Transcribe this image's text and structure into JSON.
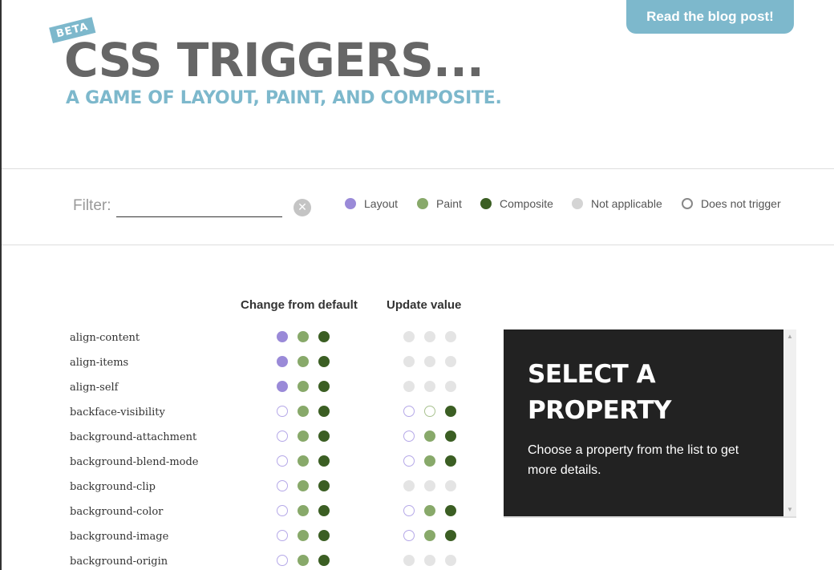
{
  "header": {
    "blog_button": "Read the blog post!",
    "badge": "BETA",
    "title": "CSS TRIGGERS...",
    "subtitle": "A GAME OF LAYOUT, PAINT, AND COMPOSITE."
  },
  "filter": {
    "label": "Filter:",
    "value": "",
    "placeholder": "",
    "clear_glyph": "✕"
  },
  "legend": [
    {
      "label": "Layout",
      "color": "#9a8ad8",
      "style": "filled"
    },
    {
      "label": "Paint",
      "color": "#88a96a",
      "style": "filled"
    },
    {
      "label": "Composite",
      "color": "#3b5e23",
      "style": "filled"
    },
    {
      "label": "Not applicable",
      "color": "#d4d4d4",
      "style": "filled"
    },
    {
      "label": "Does not trigger",
      "color": "#888888",
      "style": "outline"
    }
  ],
  "columns": {
    "change": "Change from default",
    "update": "Update value"
  },
  "properties": [
    {
      "name": "align-content",
      "change": [
        "layout",
        "paint",
        "composite"
      ],
      "update": [
        "na",
        "na",
        "na"
      ]
    },
    {
      "name": "align-items",
      "change": [
        "layout",
        "paint",
        "composite"
      ],
      "update": [
        "na",
        "na",
        "na"
      ]
    },
    {
      "name": "align-self",
      "change": [
        "layout",
        "paint",
        "composite"
      ],
      "update": [
        "na",
        "na",
        "na"
      ]
    },
    {
      "name": "backface-visibility",
      "change": [
        "none-layout",
        "paint",
        "composite"
      ],
      "update": [
        "none-layout",
        "none-paint",
        "composite"
      ]
    },
    {
      "name": "background-attachment",
      "change": [
        "none-layout",
        "paint",
        "composite"
      ],
      "update": [
        "none-layout",
        "paint",
        "composite"
      ]
    },
    {
      "name": "background-blend-mode",
      "change": [
        "none-layout",
        "paint",
        "composite"
      ],
      "update": [
        "none-layout",
        "paint",
        "composite"
      ]
    },
    {
      "name": "background-clip",
      "change": [
        "none-layout",
        "paint",
        "composite"
      ],
      "update": [
        "na",
        "na",
        "na"
      ]
    },
    {
      "name": "background-color",
      "change": [
        "none-layout",
        "paint",
        "composite"
      ],
      "update": [
        "none-layout",
        "paint",
        "composite"
      ]
    },
    {
      "name": "background-image",
      "change": [
        "none-layout",
        "paint",
        "composite"
      ],
      "update": [
        "none-layout",
        "paint",
        "composite"
      ]
    },
    {
      "name": "background-origin",
      "change": [
        "none-layout",
        "paint",
        "composite"
      ],
      "update": [
        "na",
        "na",
        "na"
      ]
    }
  ],
  "detail_panel": {
    "title": "SELECT A PROPERTY",
    "text": "Choose a property from the list to get more details."
  },
  "colors": {
    "accent": "#7db8cc",
    "layout": "#9a8ad8",
    "paint": "#88a96a",
    "composite": "#3b5e23",
    "not_applicable": "#e4e4e4",
    "panel_bg": "#222222"
  }
}
